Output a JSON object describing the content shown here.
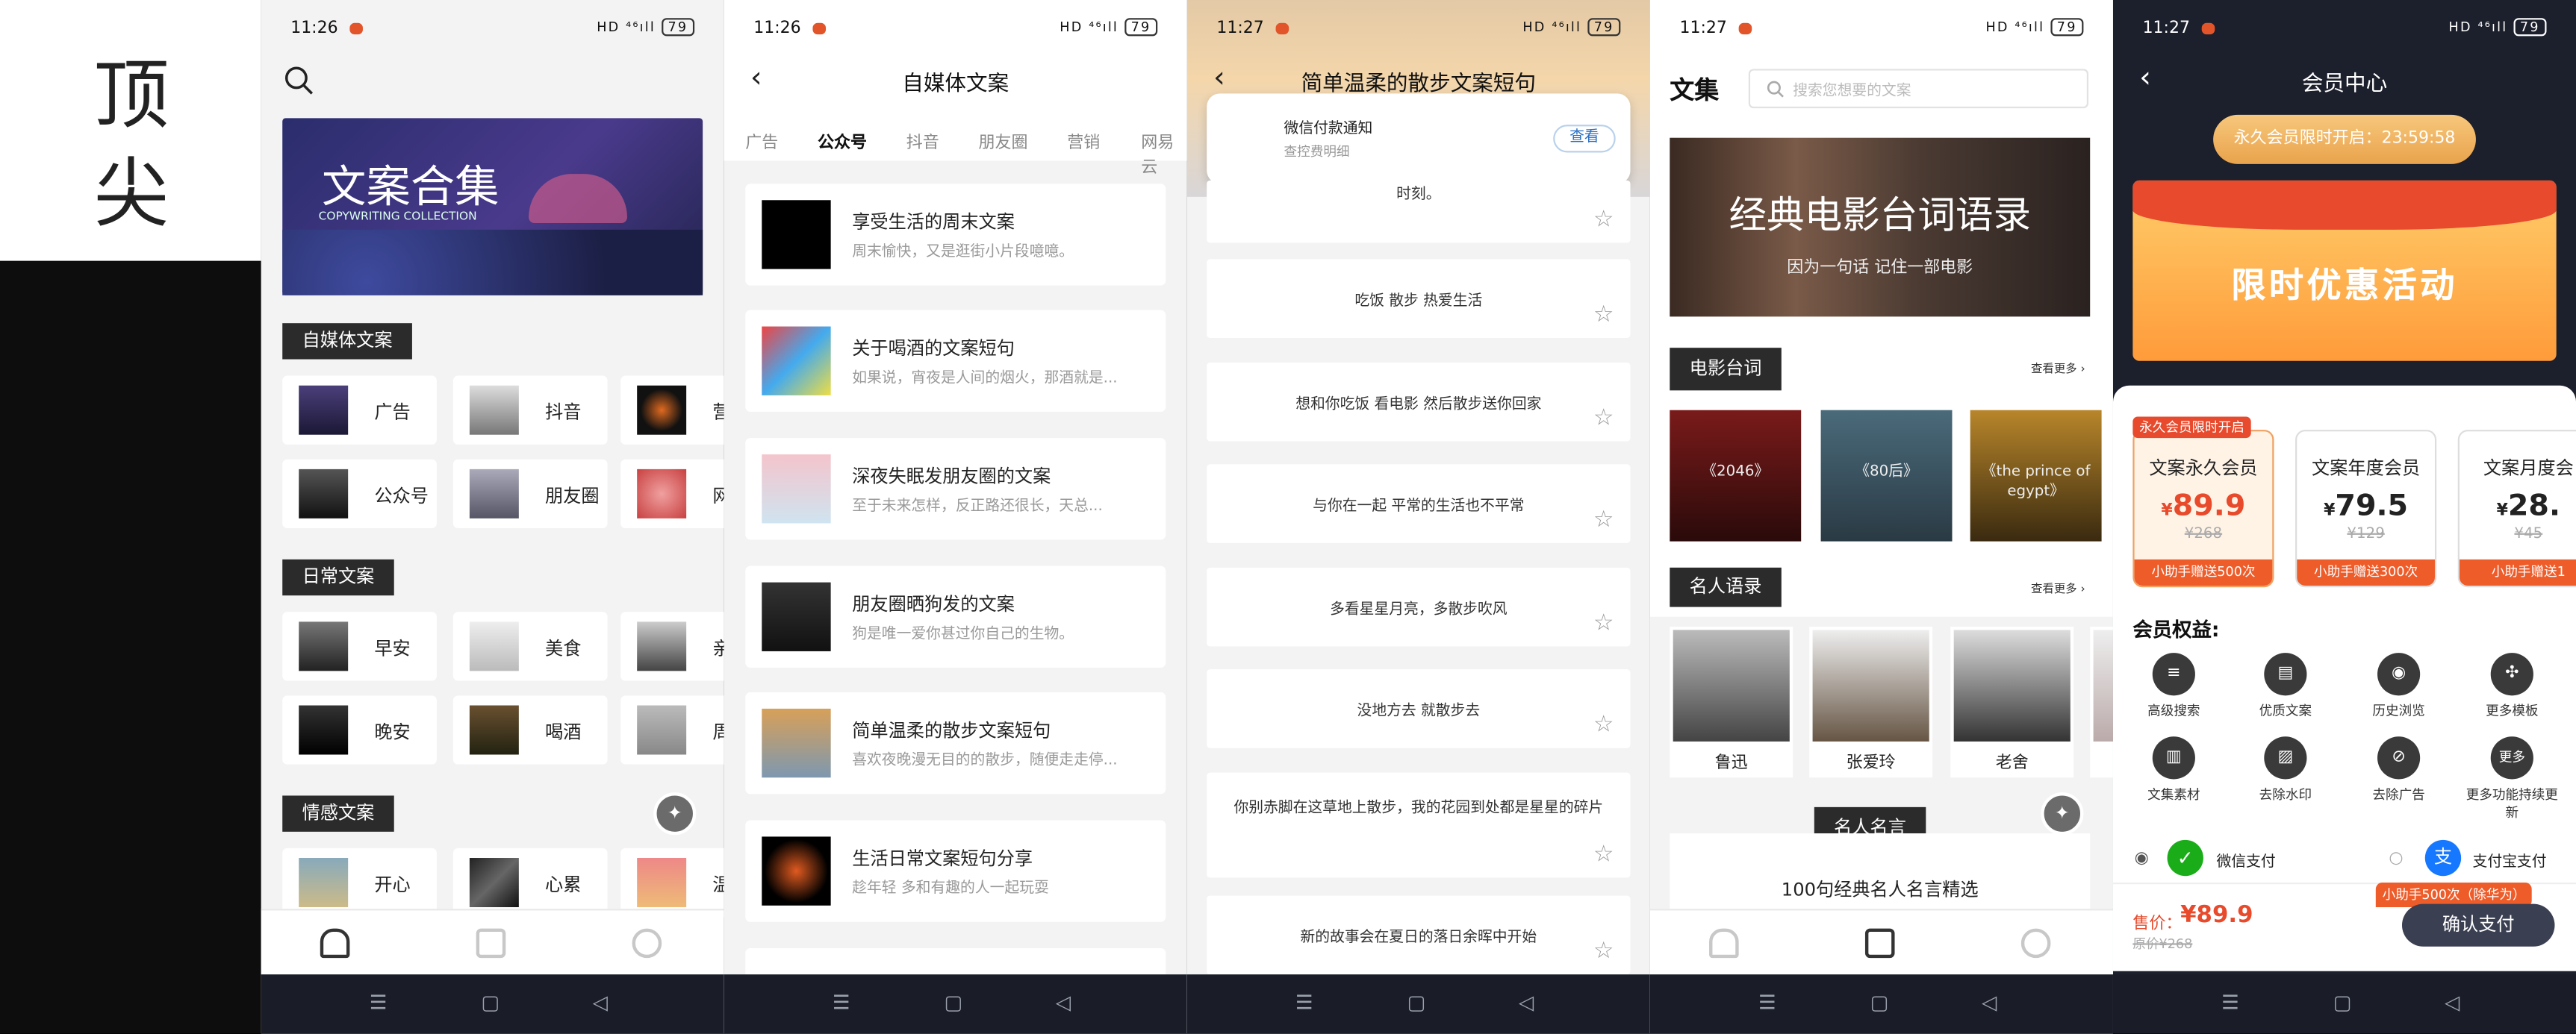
{
  "brand": {
    "line1": "顶",
    "line2": "尖"
  },
  "status": {
    "time_1": "11:26",
    "time_2": "11:26",
    "time_3": "11:27",
    "time_4": "11:27",
    "time_5": "11:27",
    "icons": "HD ⁴⁶ıll",
    "battery": "79"
  },
  "nav_glyphs": {
    "menu": "☰",
    "home": "▢",
    "back": "◁"
  },
  "s1": {
    "banner_title": "文案合集",
    "banner_sub": "COPYWRITING COLLECTION",
    "sections": [
      "自媒体文案",
      "日常文案",
      "情感文案"
    ],
    "grid1": [
      "广告",
      "抖音",
      "营",
      "公众号",
      "朋友圈",
      "网"
    ],
    "grid2": [
      "早安",
      "美食",
      "亲",
      "晚安",
      "喝酒",
      "周"
    ],
    "grid3": [
      "开心",
      "心累",
      "温"
    ]
  },
  "s2": {
    "title": "自媒体文案",
    "tabs": [
      "广告",
      "公众号",
      "抖音",
      "朋友圈",
      "营销",
      "网易云"
    ],
    "articles": [
      {
        "title": "享受生活的周末文案",
        "sub": "周末愉快，又是逛街小片段噫噫。"
      },
      {
        "title": "关于喝酒的文案短句",
        "sub": "如果说，宵夜是人间的烟火，那酒就是..."
      },
      {
        "title": "深夜失眠发朋友圈的文案",
        "sub": "至于未来怎样，反正路还很长，天总..."
      },
      {
        "title": "朋友圈晒狗发的文案",
        "sub": "狗是唯一爱你甚过你自己的生物。"
      },
      {
        "title": "简单温柔的散步文案短句",
        "sub": "喜欢夜晚漫无目的的散步，随便走走停..."
      },
      {
        "title": "生活日常文案短句分享",
        "sub": "趁年轻 多和有趣的人一起玩耍"
      }
    ]
  },
  "s3": {
    "title": "简单温柔的散步文案短句",
    "notice_title": "微信付款通知",
    "notice_sub": "查控费明细",
    "notice_btn": "查看",
    "quotes": [
      "时刻。",
      "吃饭 散步 热爱生活",
      "想和你吃饭 看电影 然后散步送你回家",
      "与你在一起 平常的生活也不平常",
      "多看星星月亮，多散步吹风",
      "没地方去 就散步去",
      "你别赤脚在这草地上散步，我的花园到处都是星星的碎片",
      "新的故事会在夏日的落日余晖中开始"
    ],
    "star": "☆"
  },
  "s4": {
    "title": "文集",
    "search_placeholder": "搜索您想要的文案",
    "banner_title": "经典电影台词语录",
    "banner_sub": "因为一句话   记住一部电影",
    "sec1": "电影台词",
    "sec2": "名人语录",
    "more": "查看更多 ›",
    "movies": [
      "《2046》",
      "《80后》",
      "《the prince of egypt》"
    ],
    "people": [
      "鲁迅",
      "张爱玲",
      "老舍"
    ],
    "quotes_tag": "名人名言",
    "quotes_item": "100句经典名人名言精选"
  },
  "s5": {
    "title": "会员中心",
    "timer": "永久会员限时开启：23:59:58",
    "promo": "限时优惠活动",
    "plan_tag": "永久会员限时开启",
    "plans": [
      {
        "name": "文案永久会员",
        "price": "89.9",
        "orig": "¥268",
        "bonus": "小助手赠送500次"
      },
      {
        "name": "文案年度会员",
        "price": "79.5",
        "orig": "¥129",
        "bonus": "小助手赠送300次"
      },
      {
        "name": "文案月度会",
        "price": "28.",
        "orig": "¥45",
        "bonus": "小助手赠送1"
      }
    ],
    "currency": "¥",
    "benefits_title": "会员权益:",
    "benefits": [
      "高级搜索",
      "优质文案",
      "历史浏览",
      "更多模板",
      "文集素材",
      "去除水印",
      "去除广告",
      "更多功能持续更新"
    ],
    "more_glyph": "更多",
    "pay_wechat": "微信支付",
    "pay_alipay": "支付宝支付",
    "bonus_tip": "小助手500次（除华为）",
    "price_label": "售价：",
    "price": "¥89.9",
    "price_orig": "原价¥268",
    "confirm": "确认支付"
  }
}
